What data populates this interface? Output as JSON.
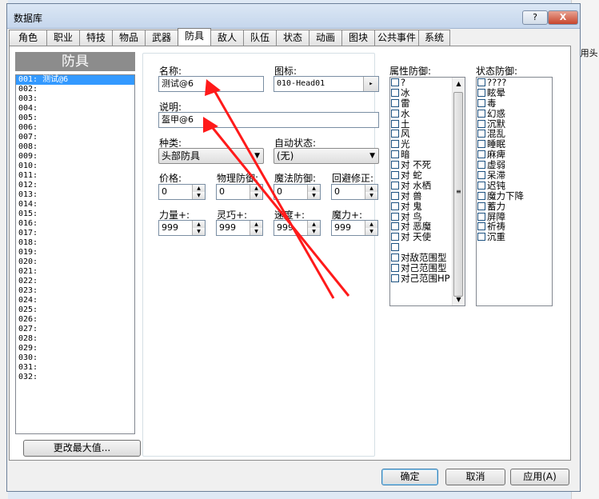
{
  "window": {
    "title": "数据库",
    "help_label": "?",
    "close_label": "X"
  },
  "background": {
    "right_text": "P用头"
  },
  "tabs": [
    "角色",
    "职业",
    "特技",
    "物品",
    "武器",
    "防具",
    "敌人",
    "队伍",
    "状态",
    "动画",
    "图块",
    "公共事件",
    "系统"
  ],
  "active_tab": "防具",
  "list": {
    "title": "防具",
    "items": [
      "001: 测试@6",
      "002:",
      "003:",
      "004:",
      "005:",
      "006:",
      "007:",
      "008:",
      "009:",
      "010:",
      "011:",
      "012:",
      "013:",
      "014:",
      "015:",
      "016:",
      "017:",
      "018:",
      "019:",
      "020:",
      "021:",
      "022:",
      "023:",
      "024:",
      "025:",
      "026:",
      "027:",
      "028:",
      "029:",
      "030:",
      "031:",
      "032:"
    ],
    "selected_index": 0,
    "change_max_label": "更改最大值..."
  },
  "form": {
    "name_label": "名称:",
    "name_value": "测试@6",
    "icon_label": "图标:",
    "icon_value": "010-Head01",
    "icon_button": "▸",
    "desc_label": "说明:",
    "desc_value": "盔甲@6",
    "kind_label": "种类:",
    "kind_value": "头部防具",
    "auto_state_label": "自动状态:",
    "auto_state_value": "(无)",
    "price_label": "价格:",
    "price_value": "0",
    "pdef_label": "物理防御:",
    "pdef_value": "0",
    "mdef_label": "魔法防御:",
    "mdef_value": "0",
    "eva_label": "回避修正:",
    "eva_value": "0",
    "str_label": "力量+:",
    "str_value": "999",
    "dex_label": "灵巧+:",
    "dex_value": "999",
    "agi_label": "速度+:",
    "agi_value": "999",
    "int_label": "魔力+:",
    "int_value": "999"
  },
  "element_defense": {
    "label": "属性防御:",
    "items": [
      "?",
      "冰",
      "雷",
      "水",
      "土",
      "风",
      "光",
      "暗",
      "对 不死",
      "对 蛇",
      "对 水栖",
      "对 兽",
      "对 鬼",
      "对 鸟",
      "对 恶魔",
      "对 天使",
      "",
      "对敌范围型",
      "对己范围型",
      "对己范围HP"
    ]
  },
  "state_defense": {
    "label": "状态防御:",
    "items": [
      "????",
      "眩晕",
      "毒",
      "幻惑",
      "沉默",
      "混乱",
      "睡眠",
      "麻痺",
      "虚弱",
      "呆滞",
      "迟钝",
      "魔力下降",
      "蓄力",
      "屏障",
      "祈祷",
      "沉重"
    ]
  },
  "buttons": {
    "ok": "确定",
    "cancel": "取消",
    "apply": "应用(A)"
  },
  "annotation_color": "#ff1a1a"
}
